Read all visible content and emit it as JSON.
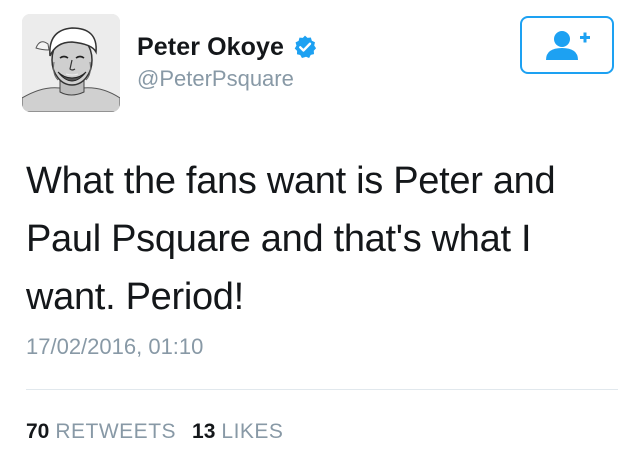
{
  "user": {
    "display_name": "Peter Okoye",
    "handle": "@PeterPsquare",
    "verified": true,
    "avatar_icon": "profile-photo-sketch"
  },
  "follow_button": {
    "icon": "add-user-icon",
    "color": "#1da1f2"
  },
  "tweet": {
    "text": "What the fans want is Peter and Paul Psquare and that's what I want. Period!",
    "timestamp": "17/02/2016, 01:10"
  },
  "stats": {
    "retweets_count": "70",
    "retweets_label": "RETWEETS",
    "likes_count": "13",
    "likes_label": "LIKES"
  },
  "colors": {
    "accent": "#1da1f2",
    "muted_text": "#8899a6",
    "primary_text": "#14171a",
    "divider": "#e1e8ed"
  }
}
